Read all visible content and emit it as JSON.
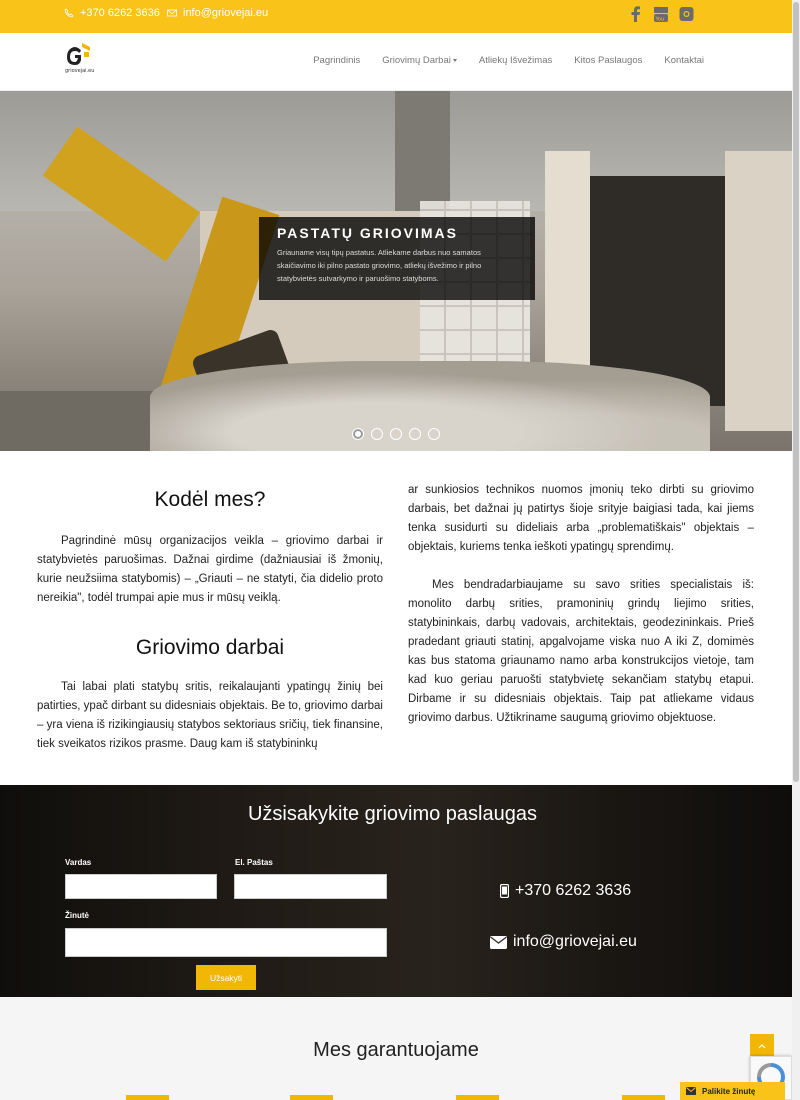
{
  "topbar": {
    "phone": "+370 6262 3636",
    "email": "info@griovejai.eu",
    "social": [
      "facebook-icon",
      "youtube-icon",
      "instagram-icon"
    ]
  },
  "header": {
    "logo_text": "griovejai.eu",
    "nav": [
      {
        "label": "Pagrindinis"
      },
      {
        "label": "Griovimų Darbai"
      },
      {
        "label": "Atliekų Išvežimas"
      },
      {
        "label": "Kitos Paslaugos"
      },
      {
        "label": "Kontaktai"
      }
    ]
  },
  "hero": {
    "title": "PASTATŲ GRIOVIMAS",
    "text": "Griauname visų tipų pastatus. Atliekame darbus nuo samatos skaičiavimo iki pilno pastato griovimo, atliekų išvežimo ir pilno statybvietės sutvarkymo ir paruošimo statyboms.",
    "slides": 5,
    "active_slide": 1
  },
  "content": {
    "h1": "Kodėl mes?",
    "p1": "Pagrindinė mūsų organizacijos veikla – griovimo darbai ir statybvietės paruošimas. Dažnai girdime (dažniausiai iš žmonių, kurie neužsiima statybomis) – „Griauti – ne statyti, čia didelio proto nereikia\", todėl trumpai apie mus ir mūsų veiklą.",
    "h2": "Griovimo darbai",
    "p2": "Tai labai plati statybų sritis, reikalaujanti ypatingų žinių bei patirties, ypač dirbant su didesniais objektais. Be to, griovimo darbai – yra viena iš rizikingiausių statybos sektoriaus sričių, tiek finansine, tiek sveikatos rizikos prasme. Daug kam iš statybininkų",
    "p3": "ar sunkiosios technikos nuomos įmonių teko dirbti su griovimo darbais, bet dažnai jų patirtys šioje srityje baigiasi tada, kai jiems tenka susidurti su dideliais arba „problematiškais\" objektais – objektais, kuriems tenka ieškoti ypatingų sprendimų.",
    "p4": "Mes bendradarbiaujame su savo srities specialistais iš: monolito darbų srities, pramoninių grindų liejimo srities, statybininkais, darbų vadovais, architektais, geodezininkais. Prieš pradedant griauti statinį, apgalvojame viska nuo A iki Z, domimės kas bus statoma griaunamo namo arba konstrukcijos vietoje, tam kad kuo geriau paruošti statybvietę sekančiam statybų etapui. Dirbame ir su didesniais objektais. Taip pat atliekame vidaus griovimo darbus. Užtikriname saugumą griovimo objektuose."
  },
  "order": {
    "title": "Užsisakykite griovimo paslaugas",
    "name_label": "Vardas",
    "email_label": "El. Paštas",
    "message_label": "Žinutė",
    "submit": "Užsakyti",
    "phone": "+370 6262 3636",
    "email": "info@griovejai.eu"
  },
  "bottom": {
    "title": "Mes garantuojame",
    "message_button": "Palikite žinutę"
  },
  "colors": {
    "accent": "#f9c31a",
    "button": "#f2b705"
  }
}
